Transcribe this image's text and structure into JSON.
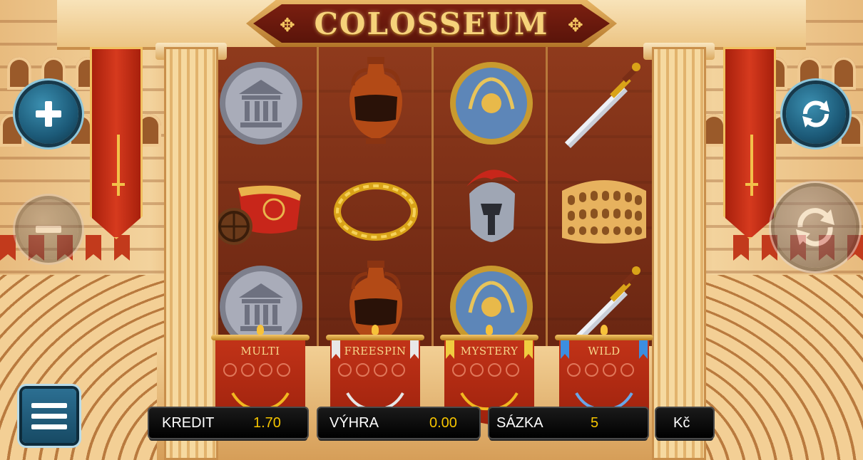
{
  "game": {
    "title": "COLOSSEUM"
  },
  "reels": [
    {
      "symbols": [
        "temple-coin",
        "chariot",
        "temple-coin"
      ]
    },
    {
      "symbols": [
        "amphora",
        "laurel-wreath",
        "amphora"
      ]
    },
    {
      "symbols": [
        "shield",
        "helmet",
        "shield"
      ]
    },
    {
      "symbols": [
        "sword",
        "colosseum",
        "sword"
      ]
    }
  ],
  "features": [
    {
      "label": "MULTI",
      "laurel_color": "#f2b820",
      "ribbon_color": null
    },
    {
      "label": "FREESPIN",
      "laurel_color": "#e6e6e6",
      "ribbon_color": "#e8e8e8"
    },
    {
      "label": "MYSTERY",
      "laurel_color": "#f2b820",
      "ribbon_color": "#f0cc40"
    },
    {
      "label": "WILD",
      "laurel_color": "#6aa6e8",
      "ribbon_color": "#3c8ee0"
    }
  ],
  "status_bar": {
    "credit_label": "KREDIT",
    "credit_value": "1.70",
    "win_label": "VÝHRA",
    "win_value": "0.00",
    "bet_label": "SÁZKA",
    "bet_value": "5",
    "currency": "Kč"
  },
  "controls": {
    "increase_icon": "plus-icon",
    "decrease_icon": "minus-icon",
    "spin_icon": "refresh-icon",
    "autospin_icon": "autospin-icon",
    "menu_icon": "hamburger-icon"
  },
  "colors": {
    "title_gold": "#f6d27a",
    "value_yellow": "#f5c400",
    "banner_red": "#d63a1e",
    "button_blue": "#1c5a78"
  }
}
